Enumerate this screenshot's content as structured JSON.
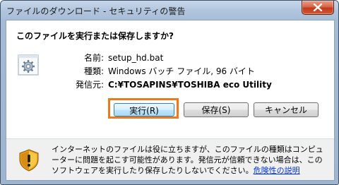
{
  "window": {
    "title": "ファイルのダウンロード - セキュリティの警告"
  },
  "dialog": {
    "question": "このファイルを実行または保存しますか?",
    "file_icon": "batch-file-gear-icon",
    "labels": {
      "name": "名前:",
      "type": "種類:",
      "from": "発信元:"
    },
    "values": {
      "name": "setup_hd.bat",
      "type": "Windows バッチ ファイル, 96 バイト",
      "from": "C:¥TOSAPINS¥TOSHIBA eco Utility"
    },
    "buttons": {
      "run": "実行(R)",
      "save": "保存(S)",
      "cancel": "キャンセル"
    }
  },
  "footer": {
    "icon": "security-warning-shield-icon",
    "warning_text": "インターネットのファイルは役に立ちますが、このファイルの種類はコンピューターに問題を起こす可能性があります。発信元が信頼できない場合は、このソフトウェアを実行したり保存したりしないでください。",
    "link_text": "危険性の説明"
  },
  "colors": {
    "focus_ring": "#f0781c",
    "close_button": "#c0391b",
    "link": "#0033cc"
  }
}
